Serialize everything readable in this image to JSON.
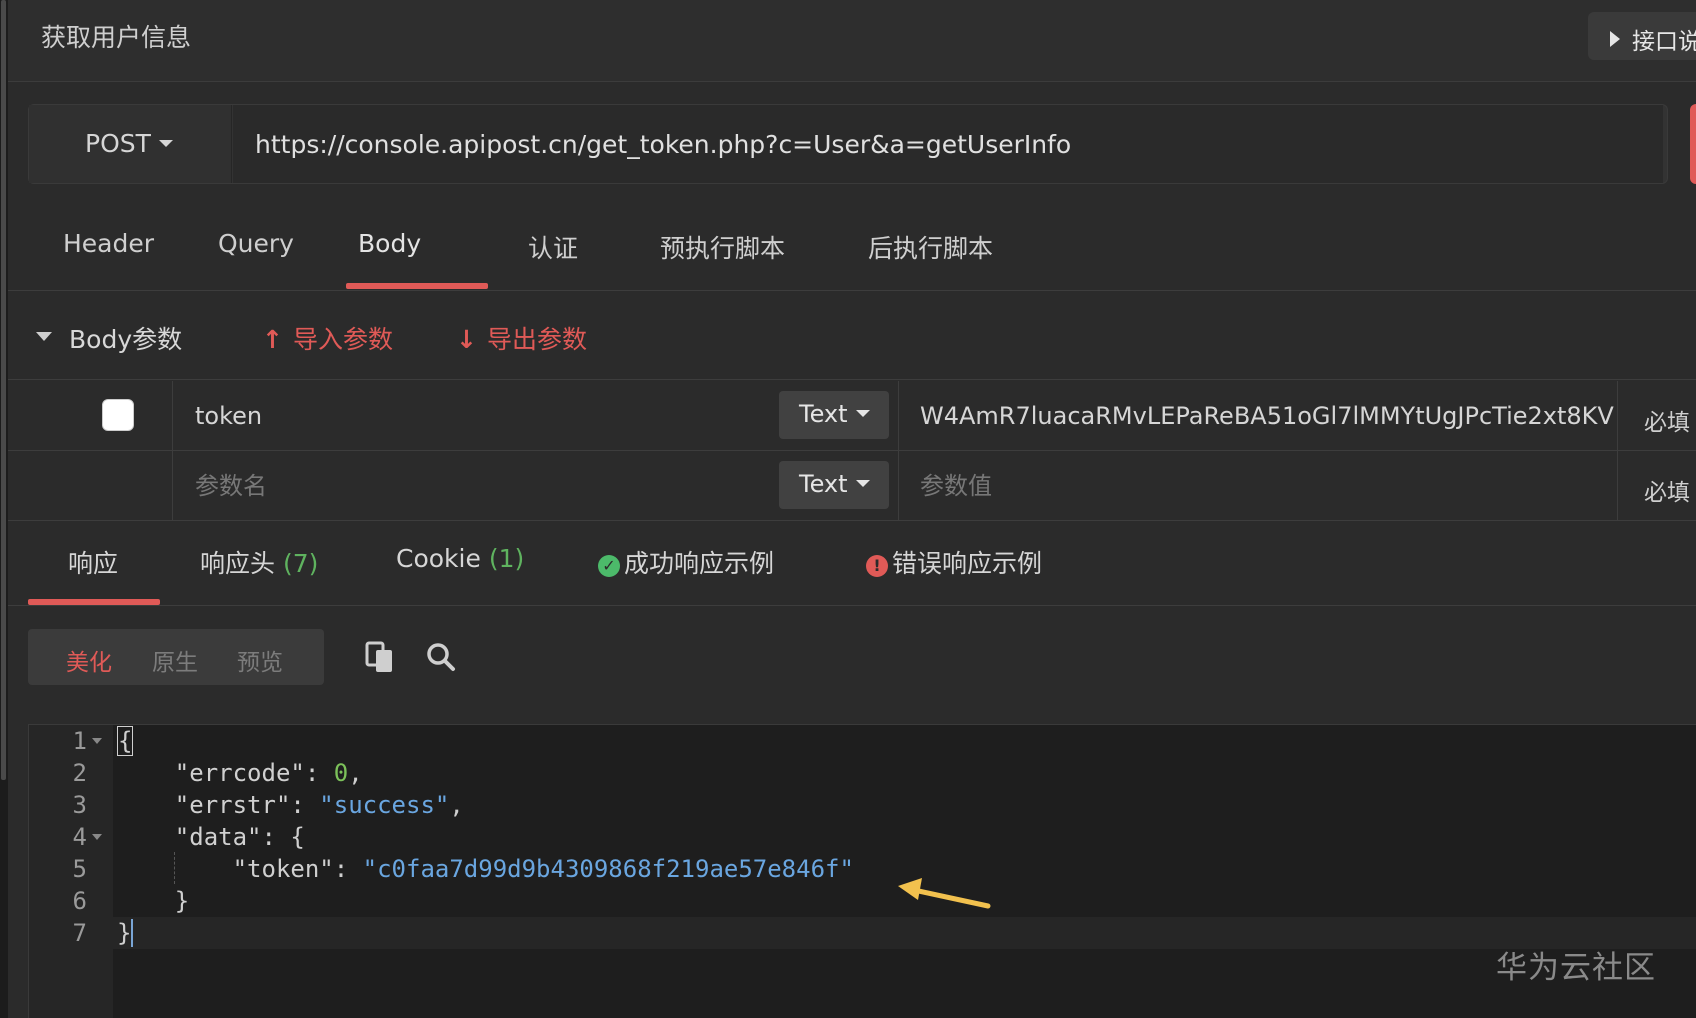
{
  "titlebar": {
    "title": "获取用户信息",
    "doc_button": "接口说"
  },
  "request": {
    "method": "POST",
    "url": "https://console.apipost.cn/get_token.php?c=User&a=getUserInfo"
  },
  "request_tabs": [
    {
      "label": "Header"
    },
    {
      "label": "Query"
    },
    {
      "label": "Body",
      "active": true
    },
    {
      "label": "认证"
    },
    {
      "label": "预执行脚本"
    },
    {
      "label": "后执行脚本"
    }
  ],
  "body_section": {
    "title": "Body参数",
    "import_label": "导入参数",
    "export_label": "导出参数"
  },
  "params": {
    "rows": [
      {
        "key": "token",
        "type": "Text",
        "value": "W4AmR7luacaRMvLEPaReBA51oGl7lMMYtUgJPcTie2xt8KV",
        "required": "必填",
        "checked": false
      },
      {
        "key": "",
        "key_placeholder": "参数名",
        "type": "Text",
        "value": "",
        "value_placeholder": "参数值",
        "required": "必填"
      }
    ]
  },
  "response_tabs": {
    "response": "响应",
    "headers": "响应头",
    "headers_count": "(7)",
    "cookie": "Cookie",
    "cookie_count": "(1)",
    "success_example": "成功响应示例",
    "error_example": "错误响应示例"
  },
  "view_modes": {
    "pretty": "美化",
    "raw": "原生",
    "preview": "预览"
  },
  "code": {
    "line_numbers": [
      "1",
      "2",
      "3",
      "4",
      "5",
      "6",
      "7"
    ],
    "errcode_key": "\"errcode\"",
    "errcode_val": "0",
    "errstr_key": "\"errstr\"",
    "errstr_val": "\"success\"",
    "data_key": "\"data\"",
    "token_key": "\"token\"",
    "token_val": "\"c0faa7d99d9b4309868f219ae57e846f\""
  },
  "watermark": "华为云社区",
  "colors": {
    "accent": "#e05a57",
    "success": "#4cba6a",
    "count": "#5fb35f",
    "string": "#6aa6e0",
    "number": "#7cc15a",
    "annotation_arrow": "#f2c14e"
  }
}
